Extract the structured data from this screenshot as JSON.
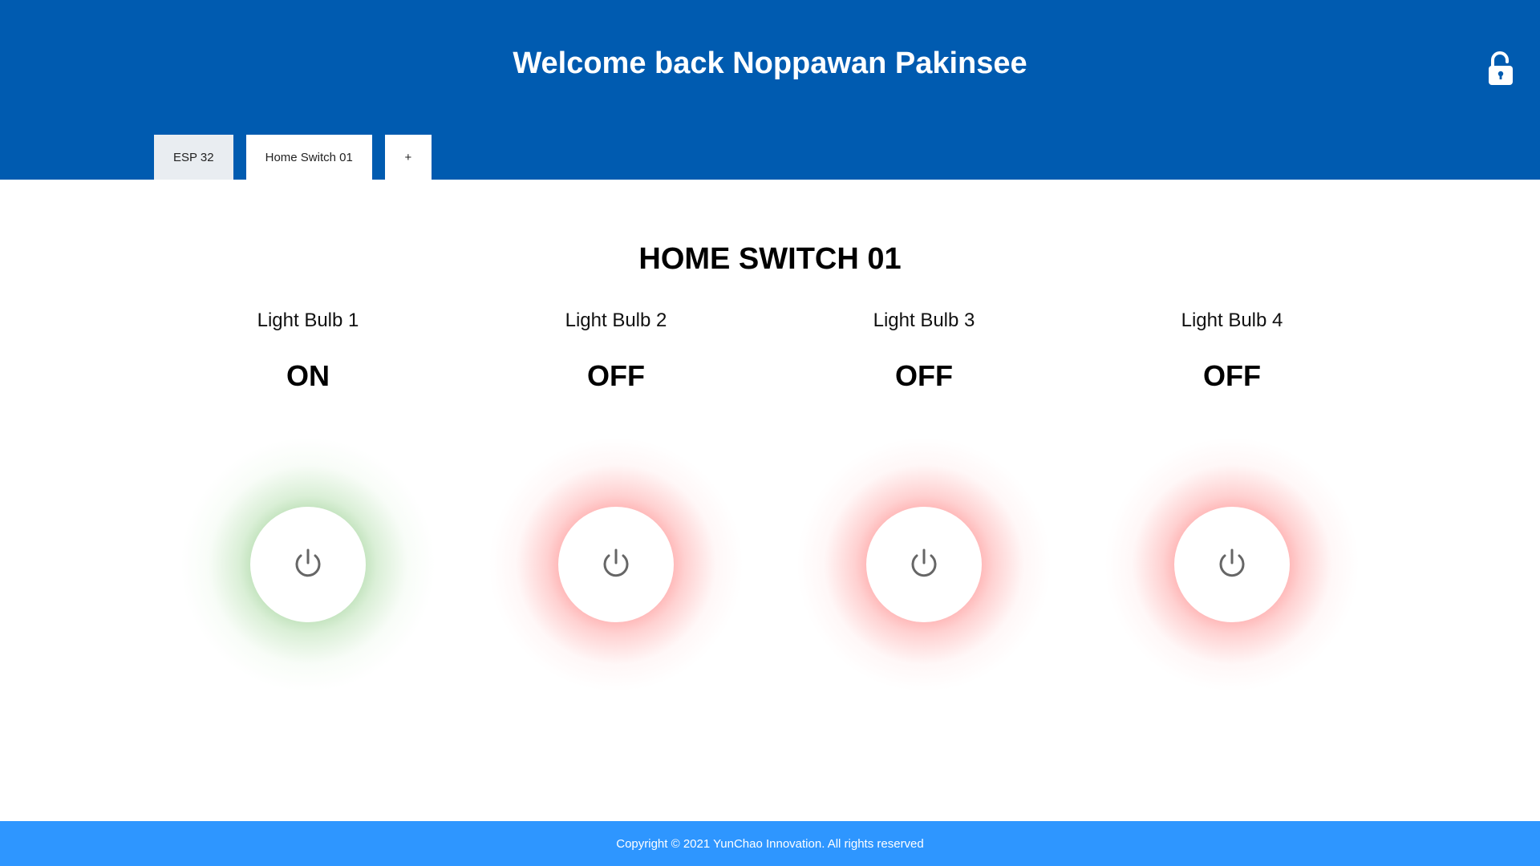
{
  "header": {
    "welcome_text": "Welcome back Noppawan Pakinsee",
    "lock_icon": "unlocked-padlock-icon"
  },
  "tabs": [
    {
      "label": "ESP 32",
      "active": false
    },
    {
      "label": "Home Switch 01",
      "active": true
    },
    {
      "label": "+",
      "active": false
    }
  ],
  "main": {
    "title": "HOME SWITCH 01",
    "switches": [
      {
        "label": "Light Bulb 1",
        "state": "ON",
        "glow_color": "#7fbf73"
      },
      {
        "label": "Light Bulb 2",
        "state": "OFF",
        "glow_color": "#ff6b6b"
      },
      {
        "label": "Light Bulb 3",
        "state": "OFF",
        "glow_color": "#ff6b6b"
      },
      {
        "label": "Light Bulb 4",
        "state": "OFF",
        "glow_color": "#ff6b6b"
      }
    ],
    "power_icon": "power-icon"
  },
  "footer": {
    "copyright": "Copyright © 2021 YunChao Innovation. All rights reserved"
  },
  "colors": {
    "header_bg": "#005bb0",
    "footer_bg": "#2e96ff",
    "inactive_tab_bg": "#e9edf1"
  }
}
